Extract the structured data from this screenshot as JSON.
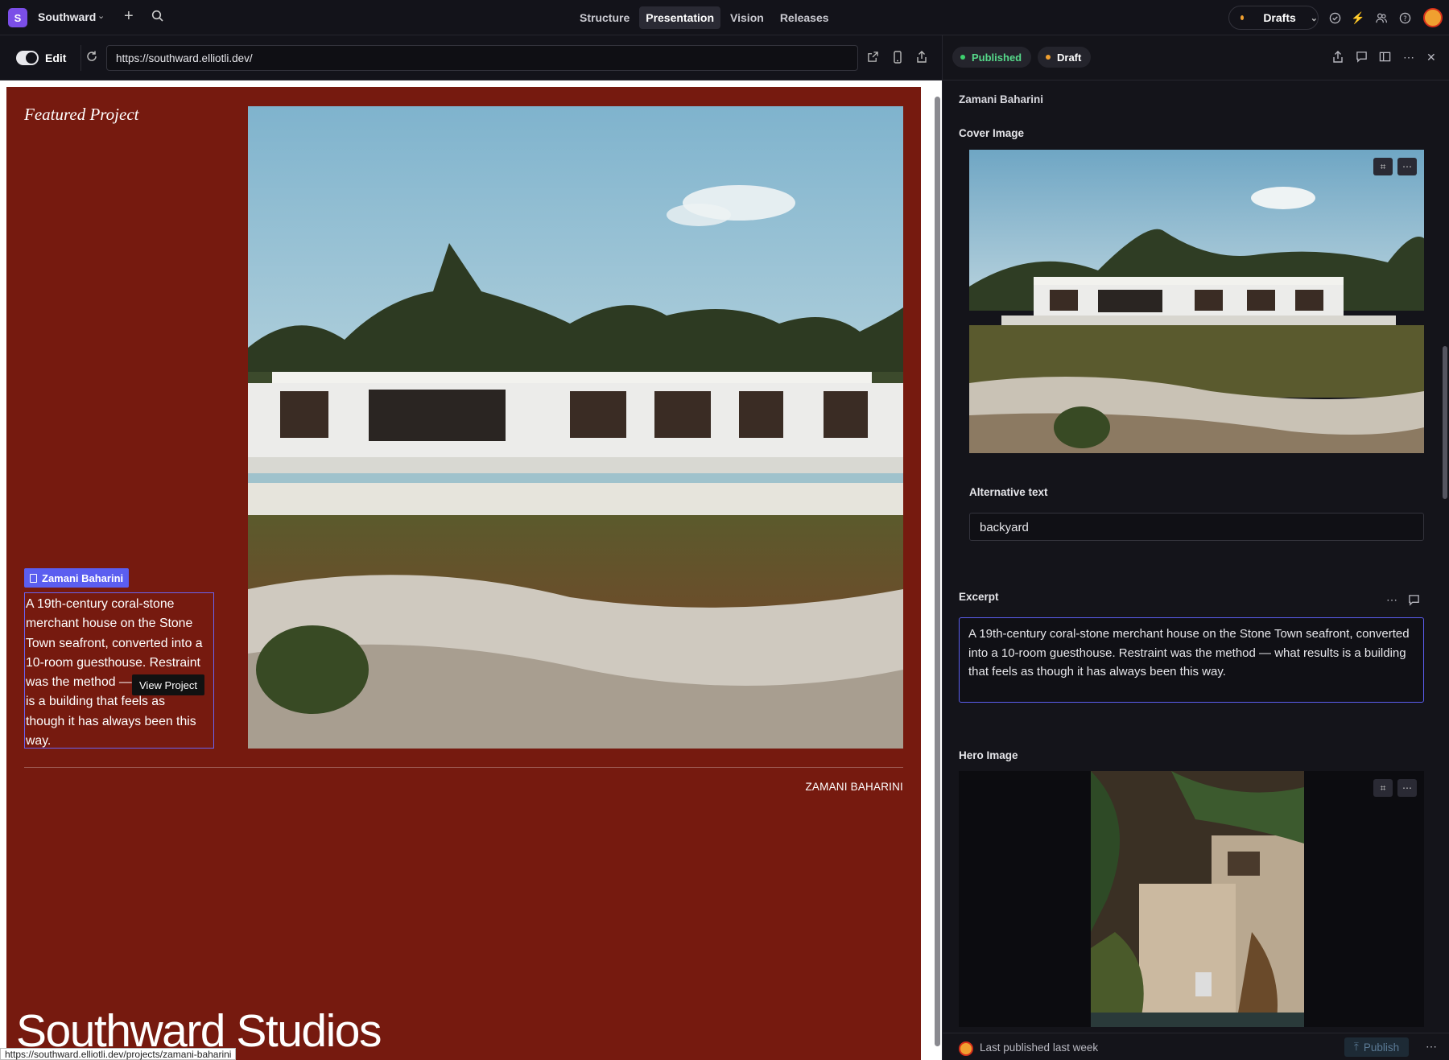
{
  "workspace": {
    "initial": "S",
    "name": "Southward"
  },
  "tabs": [
    {
      "label": "Structure",
      "active": false
    },
    {
      "label": "Presentation",
      "active": true
    },
    {
      "label": "Vision",
      "active": false
    },
    {
      "label": "Releases",
      "active": false
    }
  ],
  "drafts_label": "Drafts",
  "preview": {
    "edit_label": "Edit",
    "url": "https://southward.elliotli.dev/",
    "featured_label": "Featured Project",
    "project_tag": "Zamani Baharini",
    "excerpt_lines": [
      "A 19th-century coral-stone",
      "merchant house on the Stone",
      "Town seafront, converted into a",
      "10-room guesthouse. Restraint",
      "was the method — what results",
      "is a building that feels as",
      "though it has always been this",
      "way."
    ],
    "tooltip": "View Project",
    "credit": "ZAMANI BAHARINI",
    "brand": "Southward Studios",
    "status_url": "https://southward.elliotli.dev/projects/zamani-baharini"
  },
  "panel": {
    "published_label": "Published",
    "draft_label": "Draft",
    "doc_title": "Zamani Baharini",
    "cover_label": "Cover Image",
    "alt_label": "Alternative text",
    "alt_value": "backyard",
    "excerpt_label": "Excerpt",
    "excerpt_value": "A 19th-century coral-stone merchant house on the Stone Town seafront, converted into a 10-room guesthouse. Restraint was the method — what results is a building that feels as though it has always been this way.",
    "hero_label": "Hero Image",
    "last_published": "Last published last week",
    "publish_label": "Publish"
  },
  "colors": {
    "accent": "#5b5ef0",
    "canvas": "#761a0f",
    "published_dot": "#3ecf6e",
    "draft_dot": "#f0a030"
  }
}
